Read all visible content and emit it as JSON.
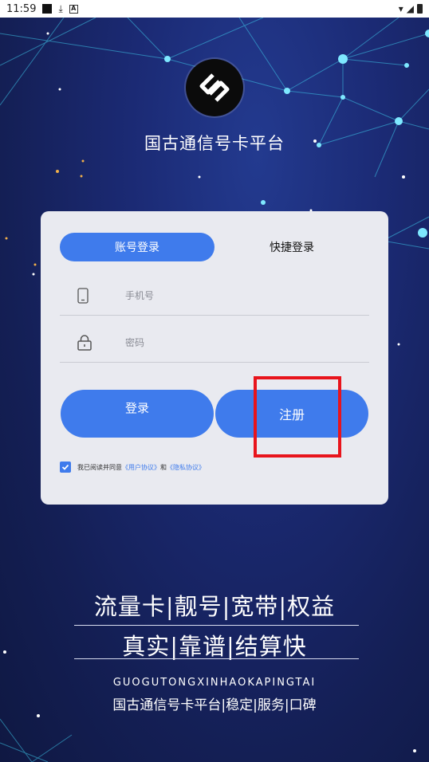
{
  "status_bar": {
    "time": "11:59",
    "download_icon": "download-icon",
    "notification_icon": "a-icon",
    "wifi_icon": "wifi-icon",
    "signal_icon": "signal-icon",
    "battery_icon": "battery-icon"
  },
  "app": {
    "title": "国古通信号卡平台",
    "logo_icon": "brand-logo-icon"
  },
  "login_card": {
    "tab_account": "账号登录",
    "tab_quick": "快捷登录",
    "phone_placeholder": "手机号",
    "password_placeholder": "密码",
    "phone_icon": "phone-icon",
    "lock_icon": "lock-icon",
    "login_button": "登录",
    "register_button": "注册",
    "agree_text": "我已阅读并同意",
    "user_agreement": "《用户协议》",
    "and_text": "和",
    "privacy_policy": "《隐私协议》",
    "agree_checked": true
  },
  "slogans": {
    "line1": "流量卡|靓号|宽带|权益",
    "line2": "真实|靠谱|结算快",
    "pinyin": "GUOGUTONGXINHAOKAPINGTAI",
    "tagline": "国古通信号卡平台|稳定|服务|口碑"
  },
  "colors": {
    "accent": "#3f7bec",
    "background": "#1b2a74",
    "card": "#e9eaf0",
    "highlight": "#e8141c"
  }
}
